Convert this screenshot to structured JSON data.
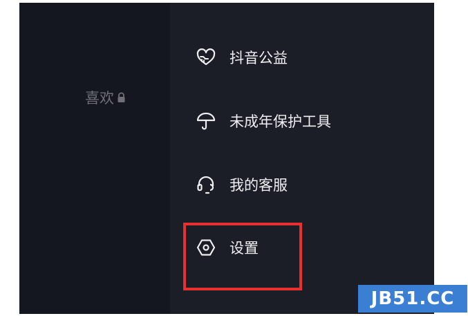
{
  "left_panel": {
    "likes_tab_label": "喜欢"
  },
  "menu": {
    "items": [
      {
        "label": "抖音公益",
        "icon": "heart-hand-icon"
      },
      {
        "label": "未成年保护工具",
        "icon": "umbrella-icon"
      },
      {
        "label": "我的客服",
        "icon": "headset-icon"
      },
      {
        "label": "设置",
        "icon": "settings-hexagon-icon"
      }
    ]
  },
  "watermark": {
    "text": "JB51.CC"
  },
  "colors": {
    "screen_background": "#181b24",
    "menu_background": "#1b1e27",
    "menu_text": "#eeeff2",
    "highlight": "#e8302f",
    "watermark_bg": "#3a7fd4"
  }
}
